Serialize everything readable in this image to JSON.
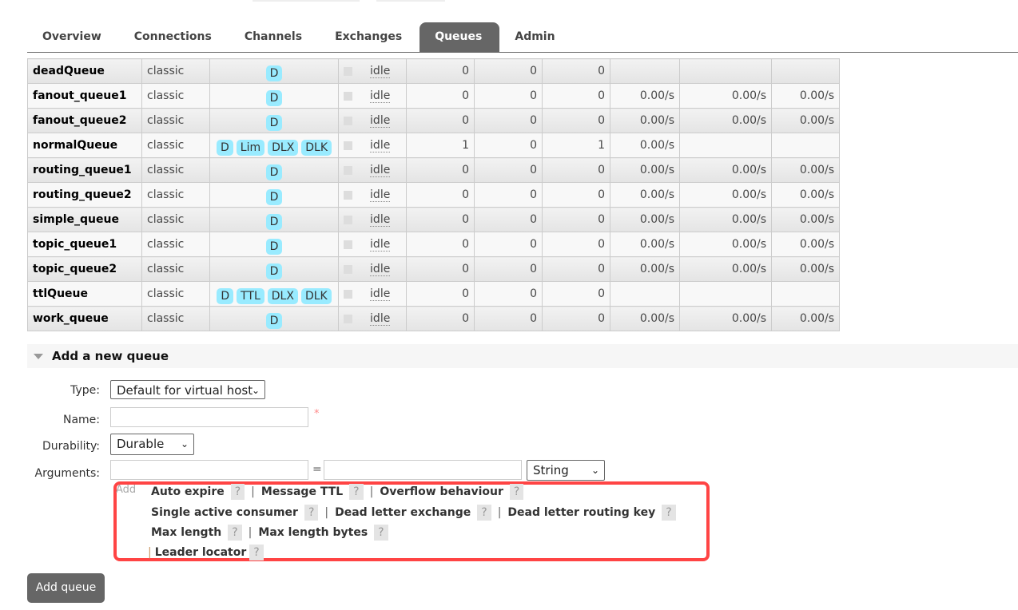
{
  "tabs": [
    "Overview",
    "Connections",
    "Channels",
    "Exchanges",
    "Queues",
    "Admin"
  ],
  "active_tab": "Queues",
  "colors": {
    "feature_badge": "#99ebff",
    "active_tab": "#666666",
    "highlight_box": "#ff4444"
  },
  "queues": [
    {
      "name": "deadQueue",
      "type": "classic",
      "features": [
        "D"
      ],
      "state": "idle",
      "ready": "0",
      "unacked": "0",
      "total": "0",
      "incoming": "",
      "deliver": "",
      "ack": ""
    },
    {
      "name": "fanout_queue1",
      "type": "classic",
      "features": [
        "D"
      ],
      "state": "idle",
      "ready": "0",
      "unacked": "0",
      "total": "0",
      "incoming": "0.00/s",
      "deliver": "0.00/s",
      "ack": "0.00/s"
    },
    {
      "name": "fanout_queue2",
      "type": "classic",
      "features": [
        "D"
      ],
      "state": "idle",
      "ready": "0",
      "unacked": "0",
      "total": "0",
      "incoming": "0.00/s",
      "deliver": "0.00/s",
      "ack": "0.00/s"
    },
    {
      "name": "normalQueue",
      "type": "classic",
      "features": [
        "D",
        "Lim",
        "DLX",
        "DLK"
      ],
      "state": "idle",
      "ready": "1",
      "unacked": "0",
      "total": "1",
      "incoming": "0.00/s",
      "deliver": "",
      "ack": ""
    },
    {
      "name": "routing_queue1",
      "type": "classic",
      "features": [
        "D"
      ],
      "state": "idle",
      "ready": "0",
      "unacked": "0",
      "total": "0",
      "incoming": "0.00/s",
      "deliver": "0.00/s",
      "ack": "0.00/s"
    },
    {
      "name": "routing_queue2",
      "type": "classic",
      "features": [
        "D"
      ],
      "state": "idle",
      "ready": "0",
      "unacked": "0",
      "total": "0",
      "incoming": "0.00/s",
      "deliver": "0.00/s",
      "ack": "0.00/s"
    },
    {
      "name": "simple_queue",
      "type": "classic",
      "features": [
        "D"
      ],
      "state": "idle",
      "ready": "0",
      "unacked": "0",
      "total": "0",
      "incoming": "0.00/s",
      "deliver": "0.00/s",
      "ack": "0.00/s"
    },
    {
      "name": "topic_queue1",
      "type": "classic",
      "features": [
        "D"
      ],
      "state": "idle",
      "ready": "0",
      "unacked": "0",
      "total": "0",
      "incoming": "0.00/s",
      "deliver": "0.00/s",
      "ack": "0.00/s"
    },
    {
      "name": "topic_queue2",
      "type": "classic",
      "features": [
        "D"
      ],
      "state": "idle",
      "ready": "0",
      "unacked": "0",
      "total": "0",
      "incoming": "0.00/s",
      "deliver": "0.00/s",
      "ack": "0.00/s"
    },
    {
      "name": "ttlQueue",
      "type": "classic",
      "features": [
        "D",
        "TTL",
        "DLX",
        "DLK"
      ],
      "state": "idle",
      "ready": "0",
      "unacked": "0",
      "total": "0",
      "incoming": "",
      "deliver": "",
      "ack": ""
    },
    {
      "name": "work_queue",
      "type": "classic",
      "features": [
        "D"
      ],
      "state": "idle",
      "ready": "0",
      "unacked": "0",
      "total": "0",
      "incoming": "0.00/s",
      "deliver": "0.00/s",
      "ack": "0.00/s"
    }
  ],
  "add_queue": {
    "title": "Add a new queue",
    "type_label": "Type:",
    "type_value": "Default for virtual host",
    "name_label": "Name:",
    "name_value": "",
    "required_mark": "*",
    "durability_label": "Durability:",
    "durability_value": "Durable",
    "arguments_label": "Arguments:",
    "arg_key": "",
    "equals": "=",
    "arg_value": "",
    "arg_type": "String",
    "add_text": "Add",
    "help": "?",
    "sep": "|",
    "args": [
      "Auto expire",
      "Message TTL",
      "Overflow behaviour",
      "Single active consumer",
      "Dead letter exchange",
      "Dead letter routing key",
      "Max length",
      "Max length bytes",
      "Leader locator"
    ],
    "submit": "Add queue"
  }
}
